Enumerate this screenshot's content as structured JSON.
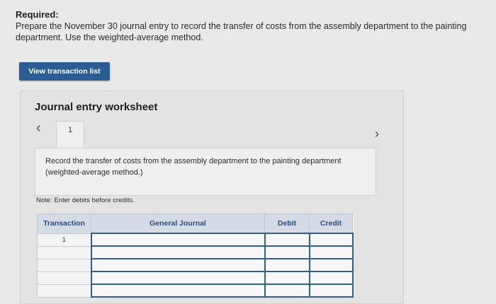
{
  "required": {
    "heading": "Required:",
    "text": "Prepare the November 30 journal entry to record the transfer of costs from the assembly department to the painting department. Use the weighted-average method."
  },
  "toolbar": {
    "view_transaction_list_label": "View transaction list"
  },
  "worksheet": {
    "title": "Journal entry worksheet",
    "tab_label": "1",
    "instruction": "Record the transfer of costs from the assembly department to the painting department (weighted-average method.)",
    "note": "Note: Enter debits before credits.",
    "nav_prev_icon": "chevron-left-icon",
    "nav_next_icon": "chevron-right-icon"
  },
  "table": {
    "headers": {
      "transaction": "Transaction",
      "general_journal": "General Journal",
      "debit": "Debit",
      "credit": "Credit"
    },
    "rows": [
      {
        "transaction": "1",
        "general_journal": "",
        "debit": "",
        "credit": ""
      },
      {
        "transaction": "",
        "general_journal": "",
        "debit": "",
        "credit": ""
      },
      {
        "transaction": "",
        "general_journal": "",
        "debit": "",
        "credit": ""
      },
      {
        "transaction": "",
        "general_journal": "",
        "debit": "",
        "credit": ""
      },
      {
        "transaction": "",
        "general_journal": "",
        "debit": "",
        "credit": ""
      }
    ]
  },
  "colors": {
    "primary_button": "#2b5d93",
    "table_header_text": "#2b4c72",
    "input_border": "#2f5f95"
  }
}
